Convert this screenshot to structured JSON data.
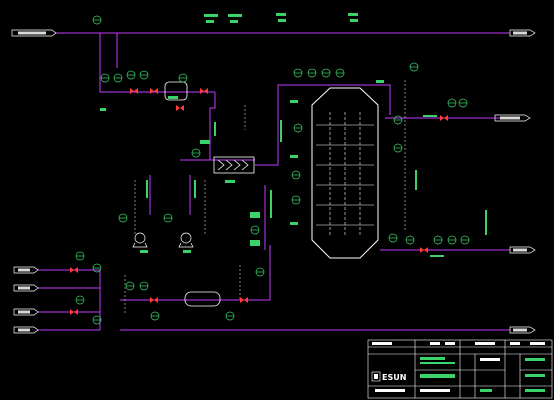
{
  "colors": {
    "background": "#000000",
    "process_line": "#c13cff",
    "instrument": "#3ad36a",
    "equipment": "#ffffff",
    "valve": "#ff3b3b",
    "dashed_signal": "#ffffff",
    "title_block": "#ffffff",
    "accent_yellow": "#ffe23a"
  },
  "title_block": {
    "logo_text": "ESUN"
  },
  "icons": {
    "brand_logo": "esun-logo-icon",
    "heat_exchanger": "heat-exchanger-icon",
    "column": "distillation-column-icon",
    "tank": "tank-icon",
    "pump": "pump-icon",
    "valve": "control-valve-icon",
    "instrument": "instrument-bubble-icon",
    "arrow": "flow-arrow-icon"
  }
}
